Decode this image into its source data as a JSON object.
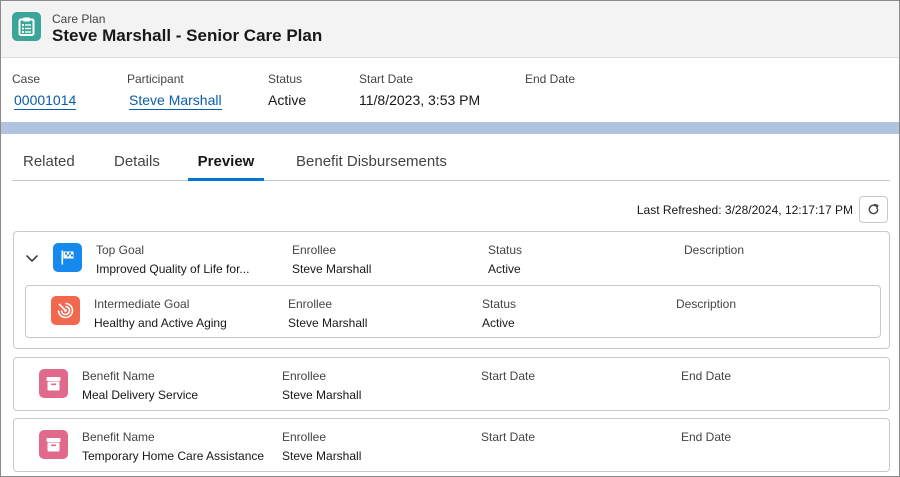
{
  "header": {
    "object_label": "Care Plan",
    "title": "Steve Marshall - Senior Care Plan",
    "icon": "care-plan-clipboard-icon"
  },
  "fields": [
    {
      "label": "Case",
      "value": "00001014",
      "is_link": true
    },
    {
      "label": "Participant",
      "value": "Steve Marshall",
      "is_link": true
    },
    {
      "label": "Status",
      "value": "Active",
      "is_link": false
    },
    {
      "label": "Start Date",
      "value": "11/8/2023, 3:53 PM",
      "is_link": false
    },
    {
      "label": "End Date",
      "value": "",
      "is_link": false
    }
  ],
  "tabs": [
    {
      "label": "Related",
      "active": false
    },
    {
      "label": "Details",
      "active": false
    },
    {
      "label": "Preview",
      "active": true
    },
    {
      "label": "Benefit Disbursements",
      "active": false
    }
  ],
  "preview": {
    "last_refreshed": "Last Refreshed: 3/28/2024, 12:17:17 PM",
    "top_goal": {
      "icon": "goal-flag-icon",
      "columns": [
        {
          "label": "Top Goal",
          "value": "Improved Quality of Life for..."
        },
        {
          "label": "Enrollee",
          "value": "Steve Marshall"
        },
        {
          "label": "Status",
          "value": "Active"
        },
        {
          "label": "Description",
          "value": ""
        }
      ],
      "intermediate_goal": {
        "icon": "target-icon",
        "columns": [
          {
            "label": "Intermediate Goal",
            "value": "Healthy and Active Aging"
          },
          {
            "label": "Enrollee",
            "value": "Steve Marshall"
          },
          {
            "label": "Status",
            "value": "Active"
          },
          {
            "label": "Description",
            "value": ""
          }
        ]
      }
    },
    "benefits": [
      {
        "icon": "archive-box-icon",
        "columns": [
          {
            "label": "Benefit Name",
            "value": "Meal Delivery Service"
          },
          {
            "label": "Enrollee",
            "value": "Steve Marshall"
          },
          {
            "label": "Start Date",
            "value": ""
          },
          {
            "label": "End Date",
            "value": ""
          }
        ]
      },
      {
        "icon": "archive-box-icon",
        "columns": [
          {
            "label": "Benefit Name",
            "value": "Temporary Home Care Assistance"
          },
          {
            "label": "Enrollee",
            "value": "Steve Marshall"
          },
          {
            "label": "Start Date",
            "value": ""
          },
          {
            "label": "End Date",
            "value": ""
          }
        ]
      }
    ]
  },
  "colors": {
    "header_icon": "#3ba59a",
    "goal_icon": "#1589ee",
    "target_icon": "#f2684e",
    "benefit_icon": "#e16a8c",
    "link": "#0b5cab",
    "tab_active": "#0176d3",
    "band": "#b0c4df"
  }
}
